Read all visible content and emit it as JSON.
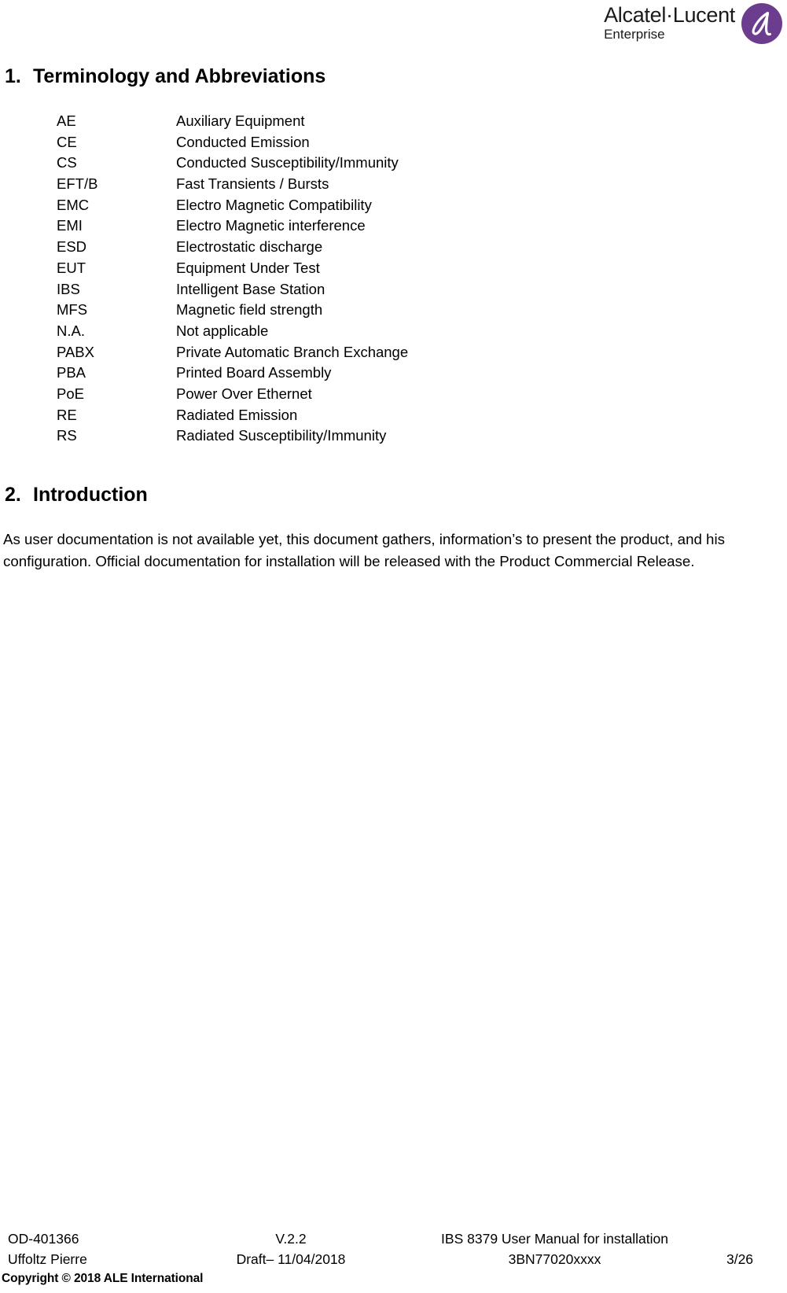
{
  "header": {
    "logo": {
      "brand": "Alcatel·Lucent",
      "sub": "Enterprise",
      "mark_icon": "ale-a-logomark",
      "mark_color": "#6c3d8f"
    }
  },
  "sections": [
    {
      "number": "1.",
      "title": "Terminology and Abbreviations"
    },
    {
      "number": "2.",
      "title": "Introduction"
    }
  ],
  "abbreviations": [
    {
      "term": "AE",
      "definition": "Auxiliary Equipment"
    },
    {
      "term": "CE",
      "definition": "Conducted Emission"
    },
    {
      "term": "CS",
      "definition": "Conducted Susceptibility/Immunity"
    },
    {
      "term": "EFT/B",
      "definition": "Fast Transients / Bursts"
    },
    {
      "term": "EMC",
      "definition": "Electro Magnetic Compatibility"
    },
    {
      "term": "EMI",
      "definition": "Electro Magnetic interference"
    },
    {
      "term": "ESD",
      "definition": "Electrostatic discharge"
    },
    {
      "term": "EUT",
      "definition": "Equipment Under Test"
    },
    {
      "term": "IBS",
      "definition": "Intelligent Base Station"
    },
    {
      "term": "MFS",
      "definition": "Magnetic field strength"
    },
    {
      "term": "N.A.",
      "definition": "Not applicable"
    },
    {
      "term": "PABX",
      "definition": "Private Automatic Branch Exchange"
    },
    {
      "term": "PBA",
      "definition": "Printed Board Assembly"
    },
    {
      "term": "PoE",
      "definition": "Power Over Ethernet"
    },
    {
      "term": "RE",
      "definition": "Radiated Emission"
    },
    {
      "term": "RS",
      "definition": "Radiated Susceptibility/Immunity"
    }
  ],
  "introduction": {
    "paragraph": "As user documentation is not available yet, this document gathers, information’s to present the product, and his configuration. Official documentation for installation will be released with the Product Commercial Release."
  },
  "footer": {
    "doc_number": "OD-401366",
    "version": "V.2.2",
    "manual_title": "IBS 8379 User Manual for installation",
    "author": "Uffoltz Pierre",
    "status_date": "Draft– 11/04/2018",
    "part_number": "3BN77020xxxx",
    "page": "3/26",
    "copyright": "Copyright © 2018 ALE International"
  }
}
